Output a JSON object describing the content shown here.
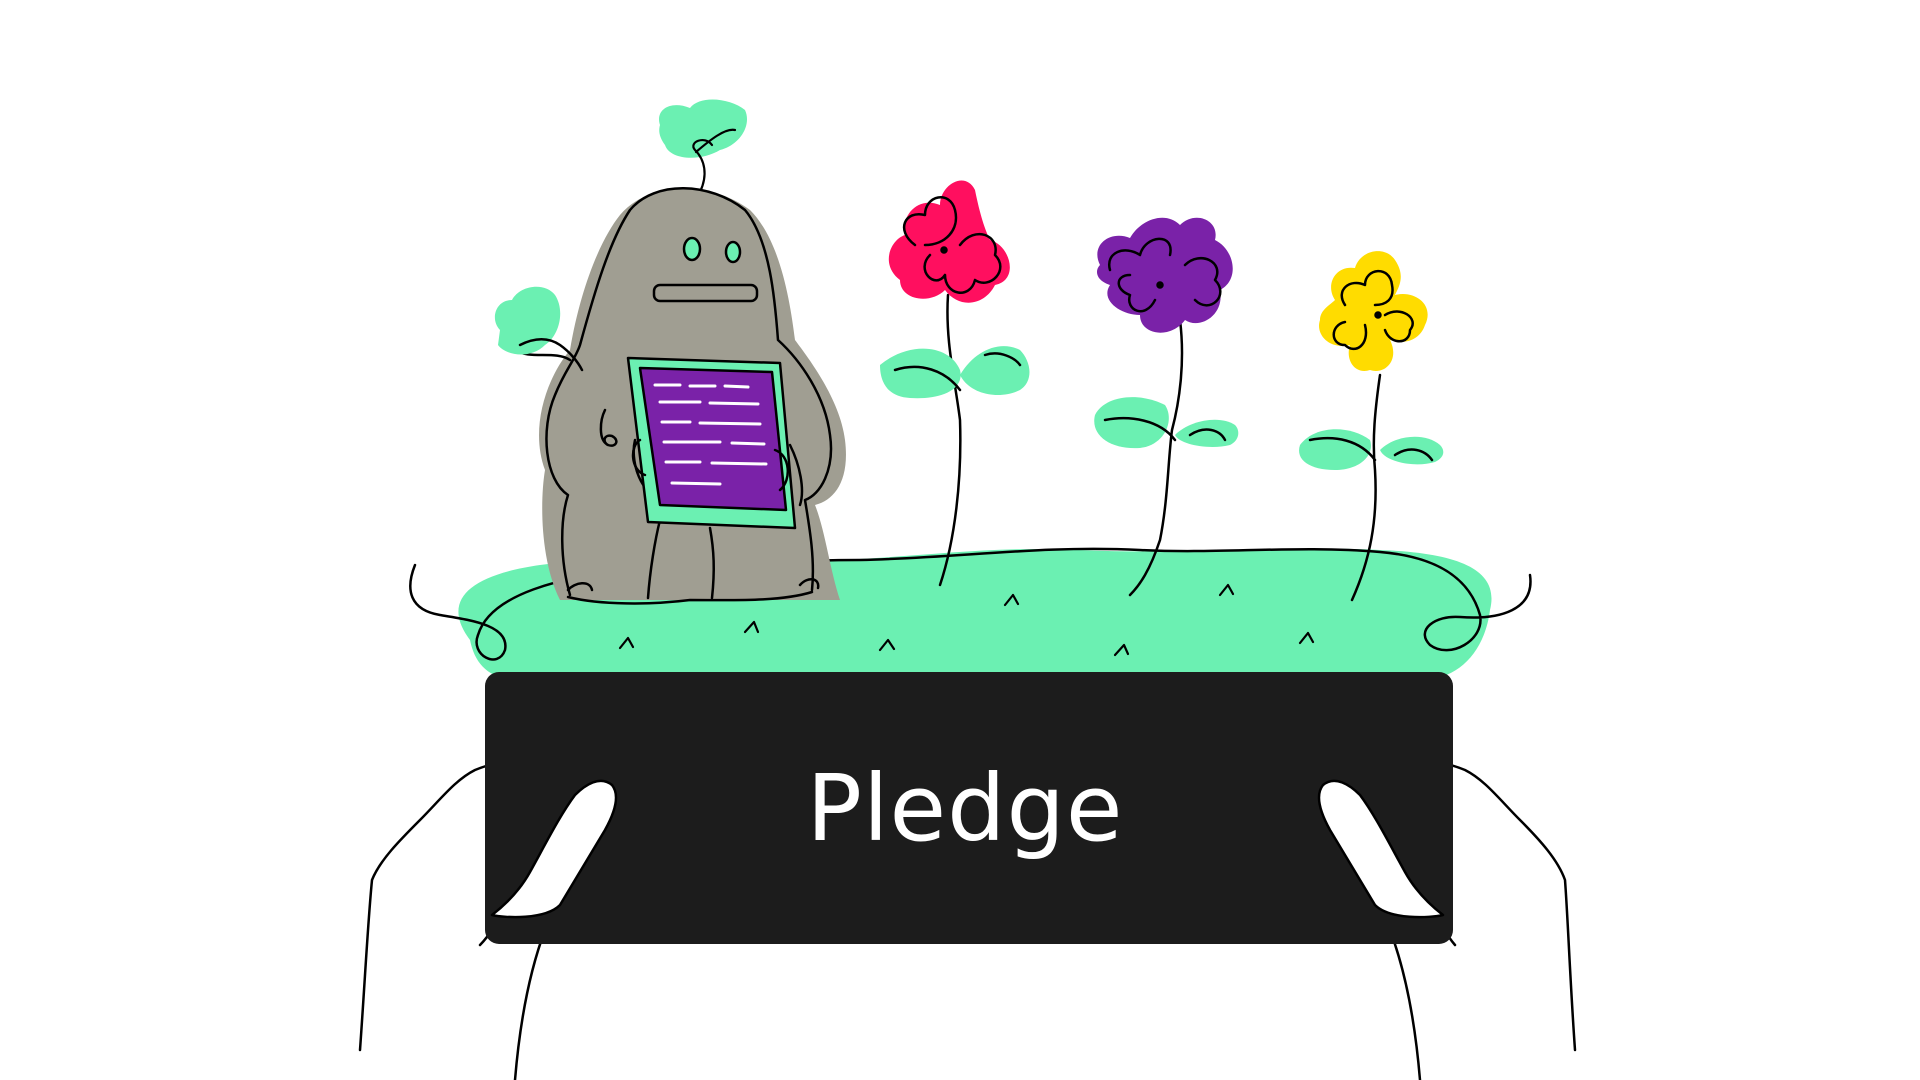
{
  "sign": {
    "label": "Pledge"
  },
  "colors": {
    "background": "#ffffff",
    "grass": "#6bf0b2",
    "leaf": "#6bf0b2",
    "robot_body": "#a09e92",
    "tablet_frame": "#6bf0b2",
    "tablet_screen": "#7a22a8",
    "flower_pink": "#ff0f5f",
    "flower_purple": "#7a22a8",
    "flower_yellow": "#ffdc00",
    "sign_board": "#1c1c1c",
    "sign_text": "#ffffff",
    "outline": "#000000"
  },
  "icons": [
    "robot-character-icon",
    "tablet-icon",
    "pink-flower-icon",
    "purple-flower-icon",
    "yellow-flower-icon",
    "sprout-leaf-icon",
    "hands-icon"
  ]
}
